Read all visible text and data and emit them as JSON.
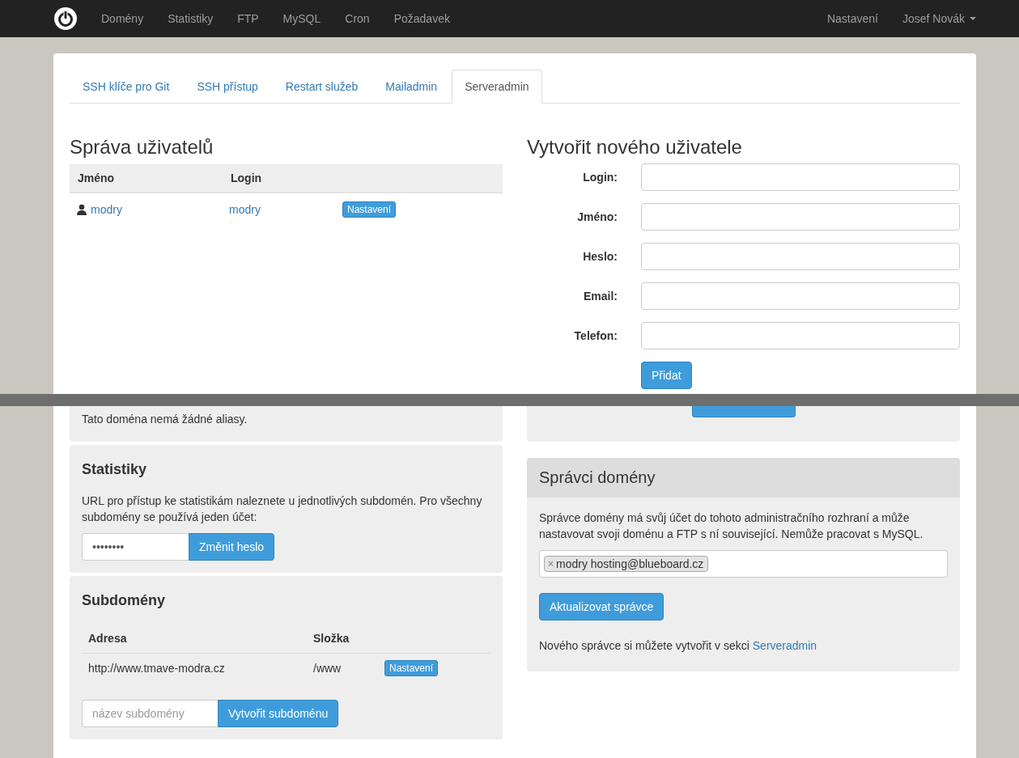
{
  "navbar": {
    "items": [
      {
        "label": "Domény"
      },
      {
        "label": "Statistiky"
      },
      {
        "label": "FTP"
      },
      {
        "label": "MySQL"
      },
      {
        "label": "Cron"
      },
      {
        "label": "Požadavek"
      }
    ],
    "right_items": [
      {
        "label": "Nastavení",
        "kind": "link"
      },
      {
        "label": "Josef Novák",
        "kind": "dropdown"
      }
    ]
  },
  "tabs": [
    {
      "label": "SSH klíče pro Git",
      "selected": false
    },
    {
      "label": "SSH přístup",
      "selected": false
    },
    {
      "label": "Restart služeb",
      "selected": false
    },
    {
      "label": "Mailadmin",
      "selected": false
    },
    {
      "label": "Serveradmin",
      "selected": true
    }
  ],
  "users": {
    "title": "Správa uživatelů",
    "columns": [
      "Jméno",
      "Login"
    ],
    "rows": [
      {
        "name": "modry",
        "login": "modry",
        "action": "Nastavení"
      }
    ]
  },
  "new_user": {
    "title": "Vytvořit nového uživatele",
    "fields": [
      {
        "label": "Login:"
      },
      {
        "label": "Jméno:"
      },
      {
        "label": "Heslo:"
      },
      {
        "label": "Email:"
      },
      {
        "label": "Telefon:"
      }
    ],
    "submit": "Přidat"
  },
  "aliases": {
    "text": "Tato doména nemá žádné aliasy."
  },
  "statistics": {
    "title": "Statistiky",
    "text": "URL pro přístup ke statistikám naleznete u jednotlivých subdomén. Pro všechny subdomény se používá jeden účet:",
    "password": "••••••••",
    "button": "Změnit heslo"
  },
  "subdomains": {
    "title": "Subdomény",
    "columns": [
      "Adresa",
      "Složka"
    ],
    "rows": [
      {
        "address": "http://www.tmave-modra.cz",
        "folder": "/www",
        "action": "Nastavení"
      }
    ],
    "placeholder": "název subdomény",
    "button": "Vytvořit subdoménu"
  },
  "admins": {
    "title": "Správci domény",
    "text": "Správce domény má svůj účet do tohoto administračního rozhraní a může nastavovat svoji doménu a FTP s ní související. Nemůže pracovat s MySQL.",
    "tags": [
      {
        "remove": "×",
        "label": "modry hosting@blueboard.cz"
      }
    ],
    "button": "Aktualizovat správce",
    "footer_text": "Nového správce si můžete vytvořit v sekci",
    "footer_link": "Serveradmin"
  }
}
